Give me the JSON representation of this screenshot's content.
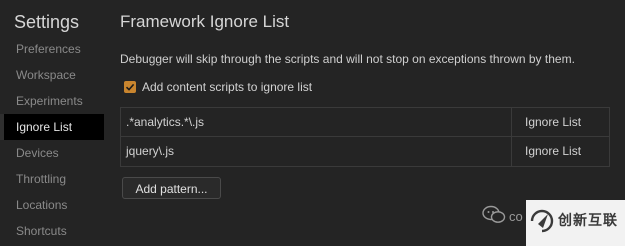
{
  "sidebar": {
    "title": "Settings",
    "items": [
      {
        "label": "Preferences",
        "active": false
      },
      {
        "label": "Workspace",
        "active": false
      },
      {
        "label": "Experiments",
        "active": false
      },
      {
        "label": "Ignore List",
        "active": true
      },
      {
        "label": "Devices",
        "active": false
      },
      {
        "label": "Throttling",
        "active": false
      },
      {
        "label": "Locations",
        "active": false
      },
      {
        "label": "Shortcuts",
        "active": false
      }
    ]
  },
  "main": {
    "title": "Framework Ignore List",
    "description": "Debugger will skip through the scripts and will not stop on exceptions thrown by them.",
    "checkbox": {
      "label": "Add content scripts to ignore list",
      "checked": true
    },
    "patterns": [
      {
        "pattern": ".*analytics.*\\.js",
        "behavior": "Ignore List"
      },
      {
        "pattern": "jquery\\.js",
        "behavior": "Ignore List"
      }
    ],
    "add_button": "Add pattern..."
  },
  "watermark": {
    "text": "co",
    "logo_text": "创新互联"
  },
  "colors": {
    "accent": "#c9852e",
    "background": "#242424",
    "active_nav": "#000000"
  }
}
